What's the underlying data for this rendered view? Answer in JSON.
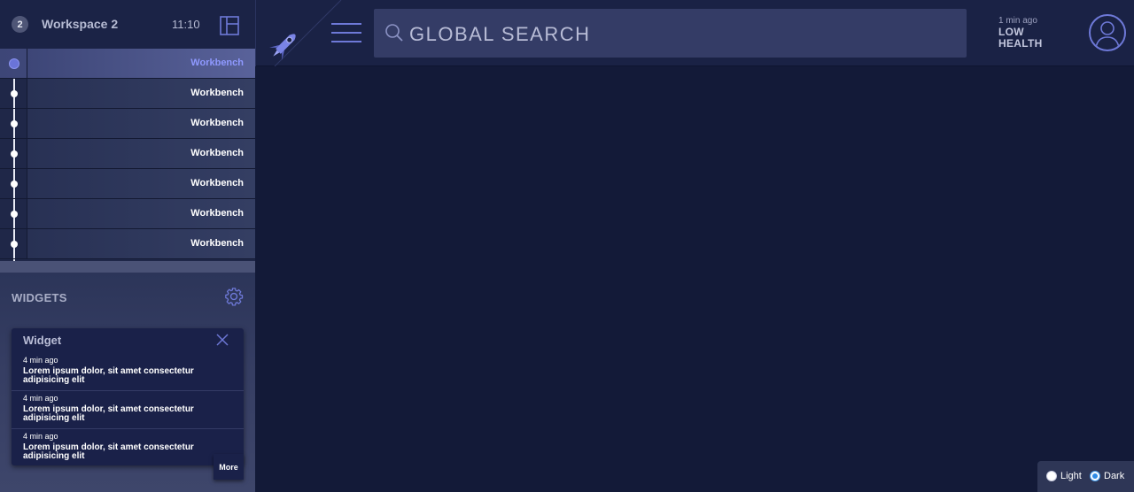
{
  "workspace": {
    "number": "2",
    "name": "Workspace 2",
    "time": "11:10"
  },
  "tabs": [
    {
      "label": "Workbench",
      "active": true
    },
    {
      "label": "Workbench",
      "active": false
    },
    {
      "label": "Workbench",
      "active": false
    },
    {
      "label": "Workbench",
      "active": false
    },
    {
      "label": "Workbench",
      "active": false
    },
    {
      "label": "Workbench",
      "active": false
    },
    {
      "label": "Workbench",
      "active": false
    }
  ],
  "widgets": {
    "title": "WIDGETS",
    "card": {
      "title": "Widget",
      "items": [
        {
          "time": "4 min ago",
          "text": "Lorem ipsum dolor, sit amet consectetur adipisicing elit"
        },
        {
          "time": "4 min ago",
          "text": "Lorem ipsum dolor, sit amet consectetur adipisicing elit"
        },
        {
          "time": "4 min ago",
          "text": "Lorem ipsum dolor, sit amet consectetur adipisicing elit"
        }
      ],
      "more_label": "More"
    }
  },
  "search": {
    "placeholder": "GLOBAL SEARCH"
  },
  "status": {
    "time": "1 min ago",
    "line1": "LOW",
    "line2": "HEALTH"
  },
  "theme": {
    "light_label": "Light",
    "dark_label": "Dark",
    "selected": "Dark"
  },
  "colors": {
    "accent": "#6e79d8",
    "active_tab_label": "#8f99ff",
    "background": "#131a38"
  },
  "icons": {
    "logo": "rocket-icon",
    "menu": "hamburger-icon",
    "search": "search-icon",
    "avatar": "user-icon",
    "settings": "gear-icon",
    "layout": "layout-icon",
    "close": "close-icon"
  }
}
